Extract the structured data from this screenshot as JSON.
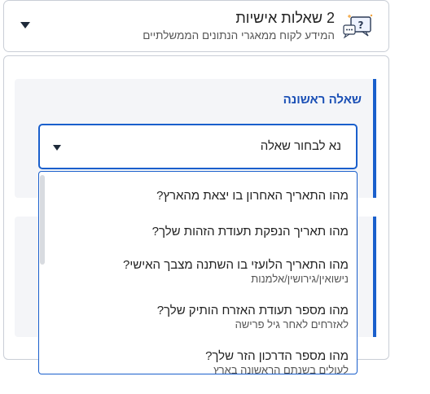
{
  "section": {
    "title": "2 שאלות אישיות",
    "subtitle": "המידע לקוח ממאגרי הנתונים הממשלתיים"
  },
  "question": {
    "label": "שאלה ראשונה",
    "select_value": "נא לבחור שאלה"
  },
  "options": [
    {
      "text": "מהו התאריך האחרון בו יצאת מהארץ?",
      "note": ""
    },
    {
      "text": "מהו תאריך הנפקת תעודת הזהות שלך?",
      "note": ""
    },
    {
      "text": "מהו התאריך הלועזי בו השתנה מצבך האישי?",
      "note": "נישואין/גירושין/אלמנות"
    },
    {
      "text": "מהו מספר תעודת האזרח הותיק שלך?",
      "note": "לאזרחים לאחר גיל פרישה"
    },
    {
      "text": "מהו מספר הדרכון הזר שלך?",
      "note": "לעולים בשנתם הראשונה בארץ"
    }
  ],
  "colors": {
    "accent": "#1a5fcc",
    "label": "#1a4fb5",
    "card_bg": "#f4f5f8"
  },
  "icons": {
    "section": "chat-question-icon",
    "expand": "chevron-down-icon"
  }
}
